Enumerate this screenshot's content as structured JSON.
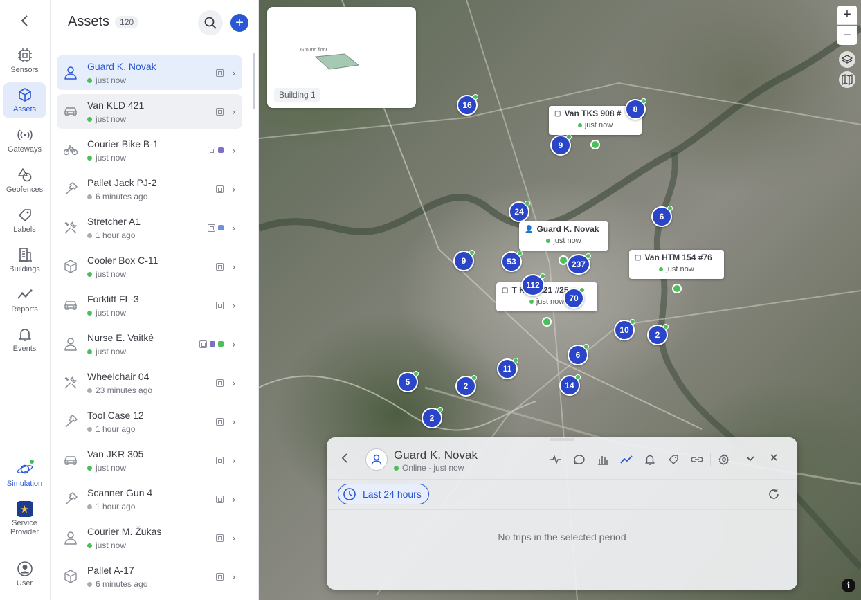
{
  "rail": {
    "back_label": "‹",
    "items": [
      {
        "label": "Sensors",
        "icon": "chip-icon"
      },
      {
        "label": "Assets",
        "icon": "cube-icon"
      },
      {
        "label": "Gateways",
        "icon": "broadcast-icon"
      },
      {
        "label": "Geofences",
        "icon": "shapes-icon"
      },
      {
        "label": "Labels",
        "icon": "tag-icon"
      },
      {
        "label": "Buildings",
        "icon": "building-icon"
      },
      {
        "label": "Reports",
        "icon": "chart-line-icon"
      },
      {
        "label": "Events",
        "icon": "bell-icon"
      }
    ],
    "simulation": "Simulation",
    "service_provider": "Service Provider",
    "user": "User"
  },
  "assets_panel": {
    "title": "Assets",
    "count": "120",
    "items": [
      {
        "name": "Guard K. Novak",
        "status": "just now",
        "dot": "green",
        "icon": "person-icon"
      },
      {
        "name": "Van KLD 421",
        "status": "just now",
        "dot": "green",
        "icon": "car-icon"
      },
      {
        "name": "Courier Bike B-1",
        "status": "just now",
        "dot": "green",
        "icon": "bike-icon",
        "swatches": [
          "#7b6fc8"
        ]
      },
      {
        "name": "Pallet Jack PJ-2",
        "status": "6 minutes ago",
        "dot": "gray",
        "icon": "hammer-icon"
      },
      {
        "name": "Stretcher A1",
        "status": "1 hour ago",
        "dot": "gray",
        "icon": "tools-icon",
        "swatches": [
          "#6f8fe0"
        ]
      },
      {
        "name": "Cooler Box C-11",
        "status": "just now",
        "dot": "green",
        "icon": "box-icon"
      },
      {
        "name": "Forklift FL-3",
        "status": "just now",
        "dot": "green",
        "icon": "car-icon"
      },
      {
        "name": "Nurse E. Vaitkė",
        "status": "just now",
        "dot": "green",
        "icon": "person-icon",
        "swatches": [
          "#7b6fc8",
          "#4bbf5a"
        ]
      },
      {
        "name": "Wheelchair 04",
        "status": "23 minutes ago",
        "dot": "gray",
        "icon": "tools-icon"
      },
      {
        "name": "Tool Case 12",
        "status": "1 hour ago",
        "dot": "gray",
        "icon": "hammer-icon"
      },
      {
        "name": "Van JKR 305",
        "status": "just now",
        "dot": "green",
        "icon": "car-icon"
      },
      {
        "name": "Scanner Gun 4",
        "status": "1 hour ago",
        "dot": "gray",
        "icon": "hammer-icon"
      },
      {
        "name": "Courier M. Žukas",
        "status": "just now",
        "dot": "green",
        "icon": "person-icon"
      },
      {
        "name": "Pallet A-17",
        "status": "6 minutes ago",
        "dot": "gray",
        "icon": "box-icon"
      }
    ]
  },
  "map": {
    "building_card": {
      "floor_label": "Ground floor",
      "label": "Building 1"
    },
    "zoom_in": "+",
    "zoom_out": "−",
    "info": "i",
    "clusters": [
      "16",
      "8",
      "9",
      "24",
      "6",
      "9",
      "53",
      "237",
      "112",
      "70",
      "10",
      "2",
      "6",
      "11",
      "5",
      "2",
      "14",
      "2"
    ],
    "tags": [
      {
        "name": "Van TKS 908 #",
        "status": "just now"
      },
      {
        "name": "Guard K. Novak",
        "status": "just now"
      },
      {
        "name": "Van HTM 154 #76",
        "status": "just now"
      },
      {
        "name": "T    KLD 421 #25",
        "status": "just now"
      }
    ]
  },
  "trip_panel": {
    "name": "Guard K. Novak",
    "status": "Online · just now",
    "period": "Last 24 hours",
    "empty_message": "No trips in the selected period",
    "accent": "#2a57d6"
  }
}
